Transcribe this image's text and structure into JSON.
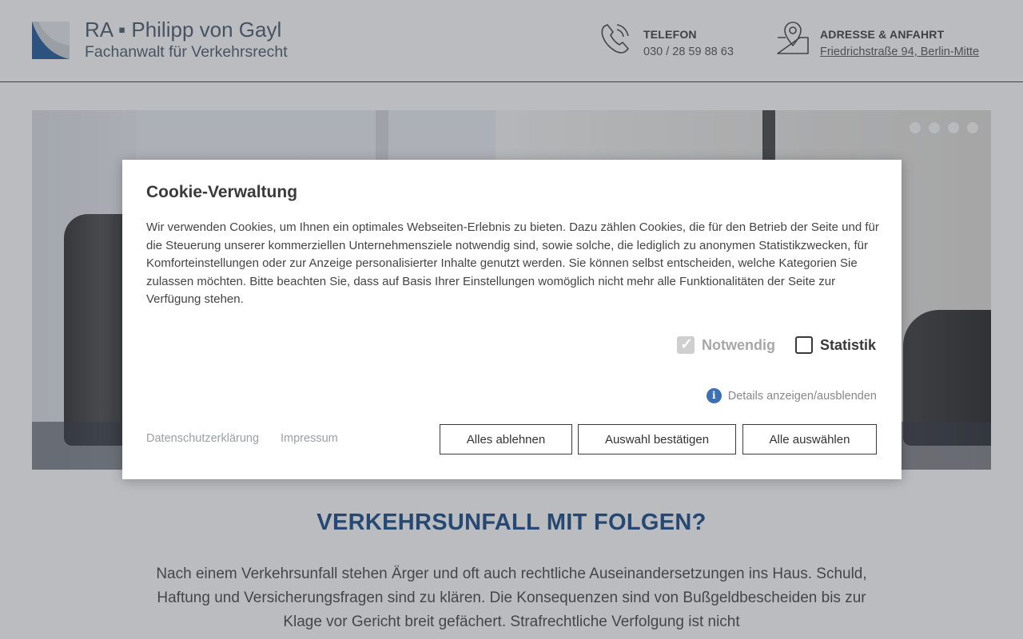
{
  "header": {
    "logo_line1": "RA ▪ Philipp von Gayl",
    "logo_line2": "Fachanwalt für Verkehrsrecht",
    "phone_title": "TELEFON",
    "phone_value": "030 / 28 59 88 63",
    "address_title": "ADRESSE & ANFAHRT",
    "address_value": "Friedrichstraße 94, Berlin-Mitte"
  },
  "slider": {
    "dots": [
      "slide-1",
      "slide-2",
      "slide-3",
      "slide-4"
    ]
  },
  "main": {
    "headline": "VERKEHRSUNFALL MIT FOLGEN?",
    "intro": "Nach einem Verkehrsunfall stehen Ärger und oft auch rechtliche Auseinandersetzungen ins Haus. Schuld, Haftung und Versicherungsfragen sind zu klären. Die Konsequenzen sind von Bußgeldbescheiden bis zur Klage vor Gericht breit gefächert. Strafrechtliche Verfolgung ist nicht"
  },
  "cookie": {
    "title": "Cookie-Verwaltung",
    "text": "Wir verwenden Cookies, um Ihnen ein optimales Webseiten-Erlebnis zu bieten. Dazu zählen Cookies, die für den Betrieb der Seite und für die Steuerung unserer kommerziellen Unternehmensziele notwendig sind, sowie solche, die lediglich zu anonymen Statistikzwecken, für Komforteinstellungen oder zur Anzeige personalisierter Inhalte genutzt werden. Sie können selbst entscheiden, welche Kategorien Sie zulassen möchten. Bitte beachten Sie, dass auf Basis Ihrer Einstellungen womöglich nicht mehr alle Funktionalitäten der Seite zur Verfügung stehen.",
    "option_necessary": "Notwendig",
    "option_necessary_checked": true,
    "option_statistics": "Statistik",
    "option_statistics_checked": false,
    "details_link": "Details anzeigen/ausblenden",
    "privacy_link": "Datenschutzerklärung",
    "imprint_link": "Impressum",
    "btn_reject": "Alles ablehnen",
    "btn_confirm": "Auswahl bestätigen",
    "btn_accept_all": "Alle auswählen"
  },
  "colors": {
    "brand_blue": "#003a7a",
    "info_blue": "#3d6fb5",
    "overlay": "rgba(90,96,104,0.42)"
  }
}
